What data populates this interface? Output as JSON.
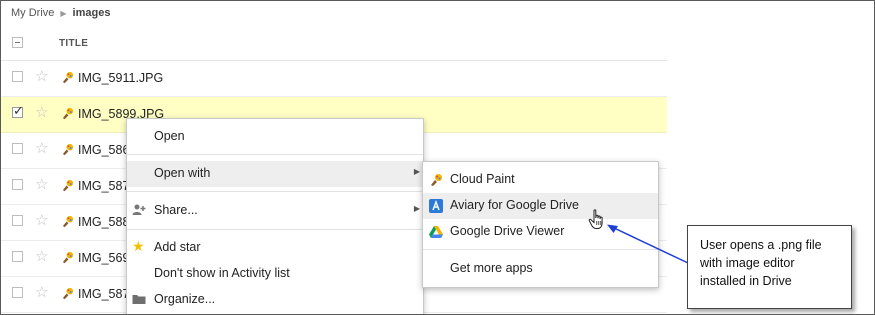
{
  "breadcrumb": {
    "root": "My Drive",
    "current": "images"
  },
  "list": {
    "title_header": "TITLE",
    "rows": [
      {
        "name": "IMG_5911.JPG"
      },
      {
        "name": "IMG_5899.JPG"
      },
      {
        "name": "IMG_586"
      },
      {
        "name": "IMG_587"
      },
      {
        "name": "IMG_588"
      },
      {
        "name": "IMG_569"
      },
      {
        "name": "IMG_587"
      }
    ]
  },
  "context_menu": {
    "open": "Open",
    "open_with": "Open with",
    "share": "Share...",
    "add_star": "Add star",
    "dont_show": "Don't show in Activity list",
    "organize": "Organize..."
  },
  "submenu": {
    "cloud_paint": "Cloud Paint",
    "aviary": "Aviary for Google Drive",
    "viewer": "Google Drive Viewer",
    "more_apps": "Get more apps"
  },
  "callout": {
    "text": "User opens a .png file with image editor installed in Drive"
  },
  "colors": {
    "selected_row": "#ffffc4",
    "highlight": "#eeeeee",
    "arrow": "#1f3fd6",
    "star": "#f2c200"
  }
}
